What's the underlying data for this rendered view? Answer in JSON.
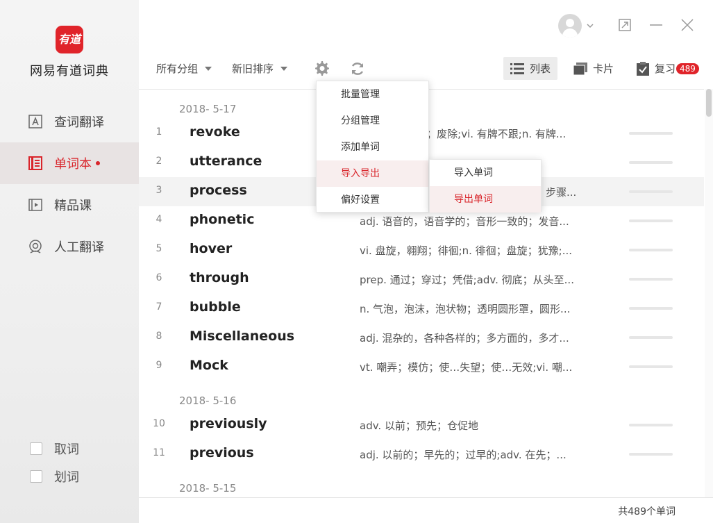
{
  "app": {
    "name": "网易有道词典",
    "logo_text": "有道"
  },
  "sidebar": {
    "nav": [
      {
        "label": "查词翻译",
        "icon": "dictionary-icon"
      },
      {
        "label": "单词本",
        "icon": "wordbook-icon",
        "active": true
      },
      {
        "label": "精品课",
        "icon": "course-icon"
      },
      {
        "label": "人工翻译",
        "icon": "human-translate-icon"
      }
    ],
    "options": [
      {
        "label": "取词",
        "checked": false
      },
      {
        "label": "划词",
        "checked": false
      }
    ]
  },
  "toolbar": {
    "group_filter": "所有分组",
    "sort": "新旧排序",
    "views": {
      "list": "列表",
      "card": "卡片",
      "review": "复习",
      "review_count": "489"
    }
  },
  "settings_menu": {
    "items": [
      "批量管理",
      "分组管理",
      "添加单词",
      "导入导出",
      "偏好设置"
    ],
    "selected": "导入导出"
  },
  "submenu": {
    "items": [
      "导入单词",
      "导出单词"
    ],
    "selected": "导出单词"
  },
  "groups": [
    {
      "date": "2018- 5-17"
    },
    {
      "date": "2018- 5-16"
    },
    {
      "date": "2018- 5-15"
    }
  ],
  "words": [
    {
      "num": "1",
      "word": "revoke",
      "def": "i；废除;vi. 有牌不跟;n. 有牌..."
    },
    {
      "num": "2",
      "word": "utterance",
      "def": ""
    },
    {
      "num": "3",
      "word": "process",
      "def": "步骤..."
    },
    {
      "num": "4",
      "word": "phonetic",
      "def": "adj. 语音的，语音学的；音形一致的；发音..."
    },
    {
      "num": "5",
      "word": "hover",
      "def": "vi. 盘旋，翱翔；徘徊;n. 徘徊；盘旋；犹豫;..."
    },
    {
      "num": "6",
      "word": "through",
      "def": "prep. 通过；穿过；凭借;adv. 彻底；从头至..."
    },
    {
      "num": "7",
      "word": "bubble",
      "def": "n. 气泡，泡沫，泡状物；透明圆形罩，圆形..."
    },
    {
      "num": "8",
      "word": "Miscellaneous",
      "def": "adj. 混杂的，各种各样的；多方面的，多才..."
    },
    {
      "num": "9",
      "word": "Mock",
      "def": "vt. 嘲弄；模仿；使…失望；使…无效;vi. 嘲..."
    },
    {
      "num": "10",
      "word": "previously",
      "def": "adv. 以前；预先；仓促地"
    },
    {
      "num": "11",
      "word": "previous",
      "def": "adj. 以前的；早先的；过早的;adv. 在先；..."
    }
  ],
  "footer": {
    "count_text": "共489个单词"
  },
  "colors": {
    "accent": "#d9252b",
    "logo": "#e0242a"
  }
}
